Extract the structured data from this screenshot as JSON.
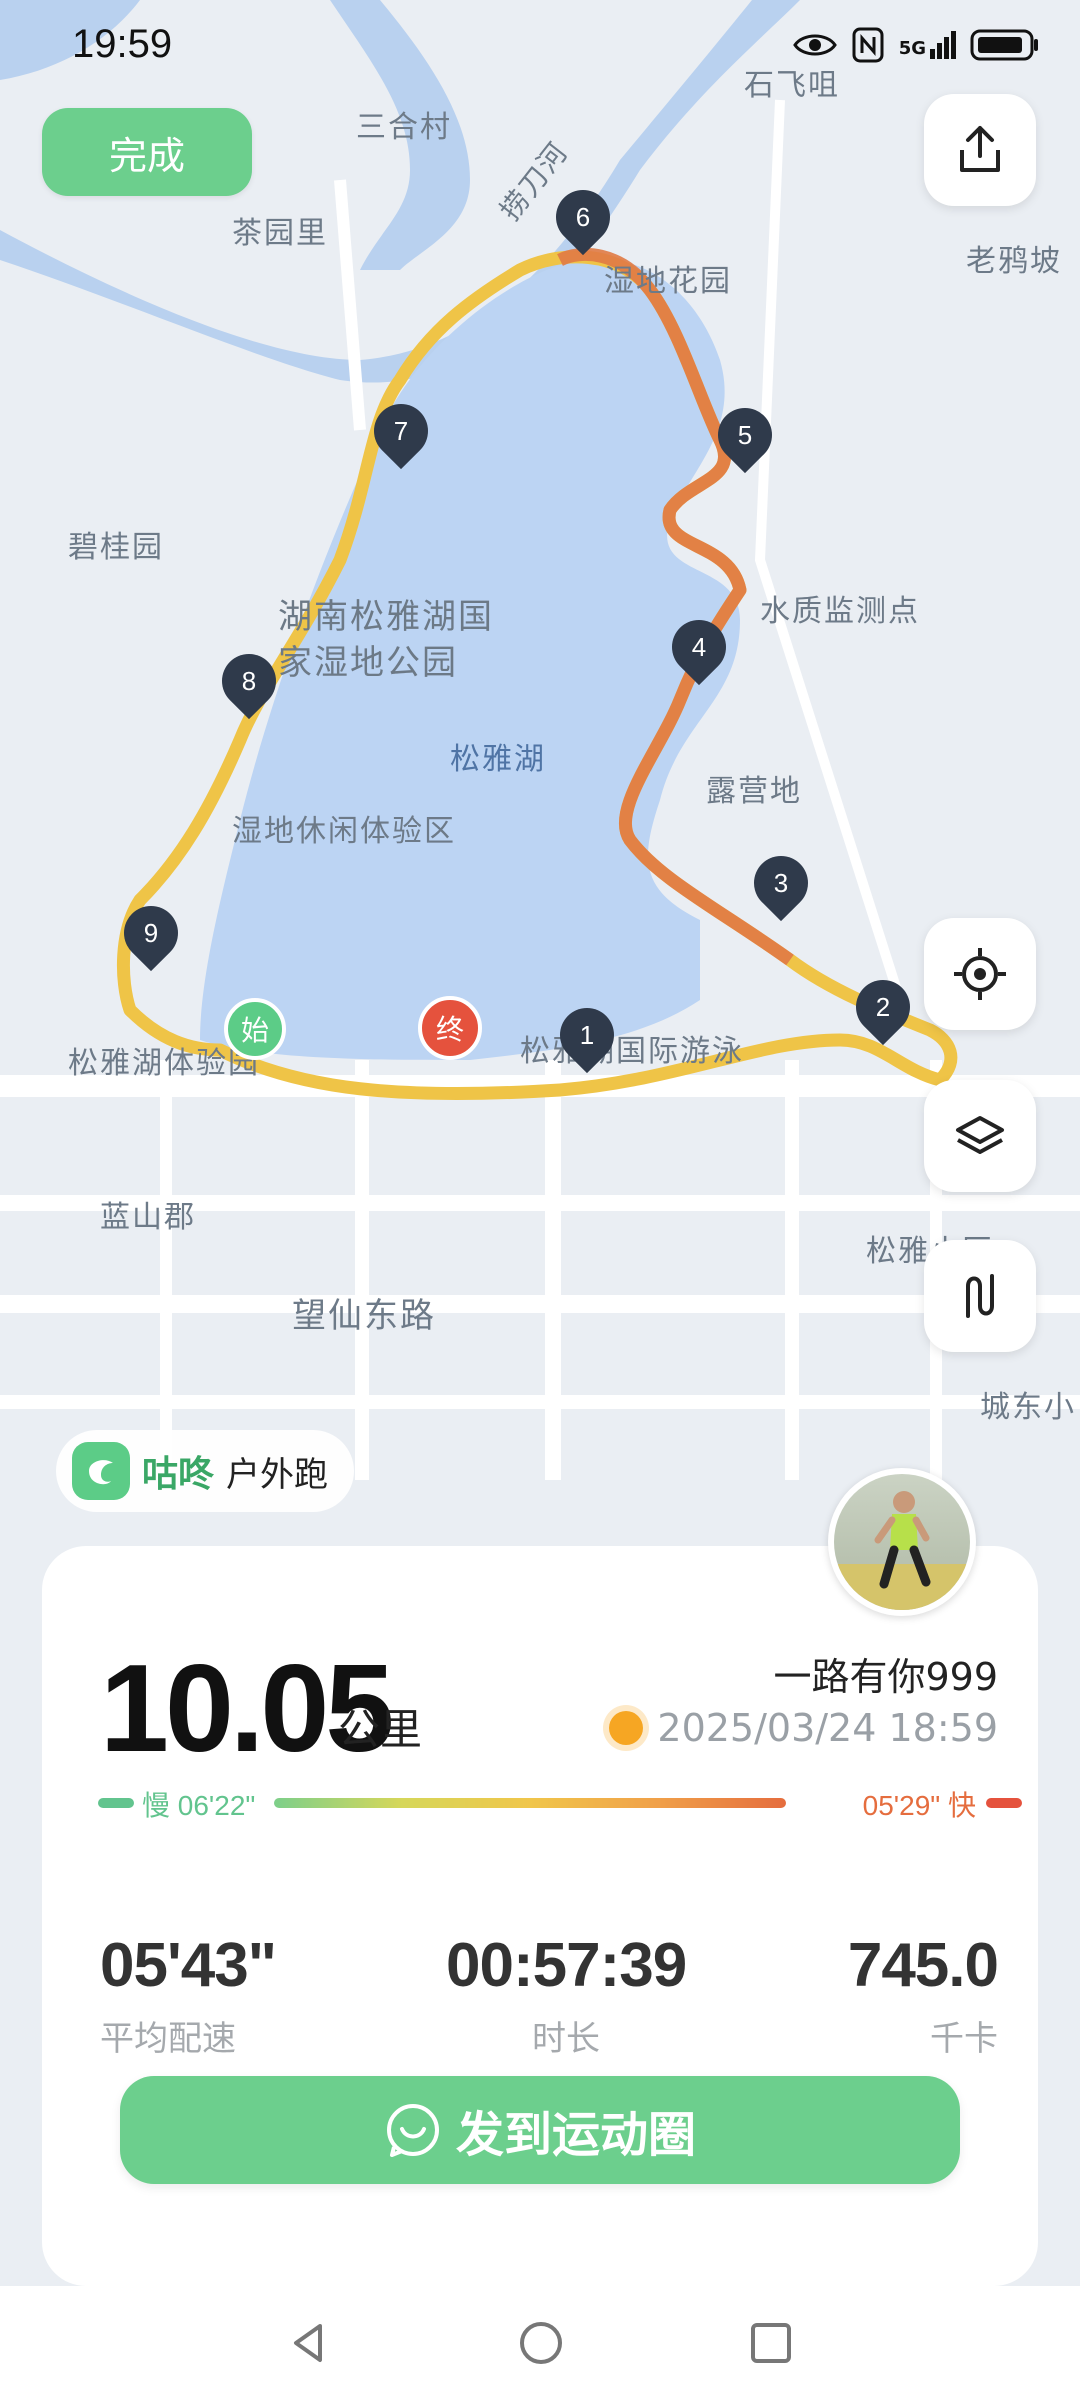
{
  "status_bar": {
    "time": "19:59",
    "network": "5G"
  },
  "top_actions": {
    "done_label": "完成"
  },
  "map": {
    "labels": {
      "sanhecun": "三合村",
      "shifeiju": "石飞咀",
      "chayuanli": "茶园里",
      "laodaohe": "捞刀河",
      "shidihuayuan": "湿地花园",
      "laoyapo": "老鸦坡",
      "biguiyuan": "碧桂园",
      "park_line1": "湖南松雅湖国",
      "park_line2": "家湿地公园",
      "shuizhi": "水质监测点",
      "songyahu": "松雅湖",
      "luyingdi": "露营地",
      "xiuxian": "湿地休闲体验区",
      "tiyuyuan": "松雅湖体验园",
      "guojiyou": "松雅湖国际游泳",
      "lanshanjun": "蓝山郡",
      "wangxian": "望仙东路",
      "songyaxiaoqu": "松雅小区",
      "chengdong": "城东小",
      "start": "始",
      "end": "终"
    },
    "markers": [
      "1",
      "2",
      "3",
      "4",
      "5",
      "6",
      "7",
      "8",
      "9"
    ]
  },
  "brand": {
    "name": "咕咚",
    "mode": "户外跑"
  },
  "summary": {
    "distance": "10.05",
    "distance_unit": "公里",
    "nickname": "一路有你999",
    "datetime": "2025/03/24 18:59",
    "pace_slow": "慢 06'22\"",
    "pace_fast": "05'29\" 快"
  },
  "stats": [
    {
      "value": "05'43\"",
      "label": "平均配速"
    },
    {
      "value": "00:57:39",
      "label": "时长"
    },
    {
      "value": "745.0",
      "label": "千卡"
    }
  ],
  "share_label": "发到运动圈",
  "colors": {
    "accent": "#6ccf8d",
    "lake": "#bcd4f3",
    "route_slow": "#efc447",
    "route_fast": "#e07a45"
  }
}
